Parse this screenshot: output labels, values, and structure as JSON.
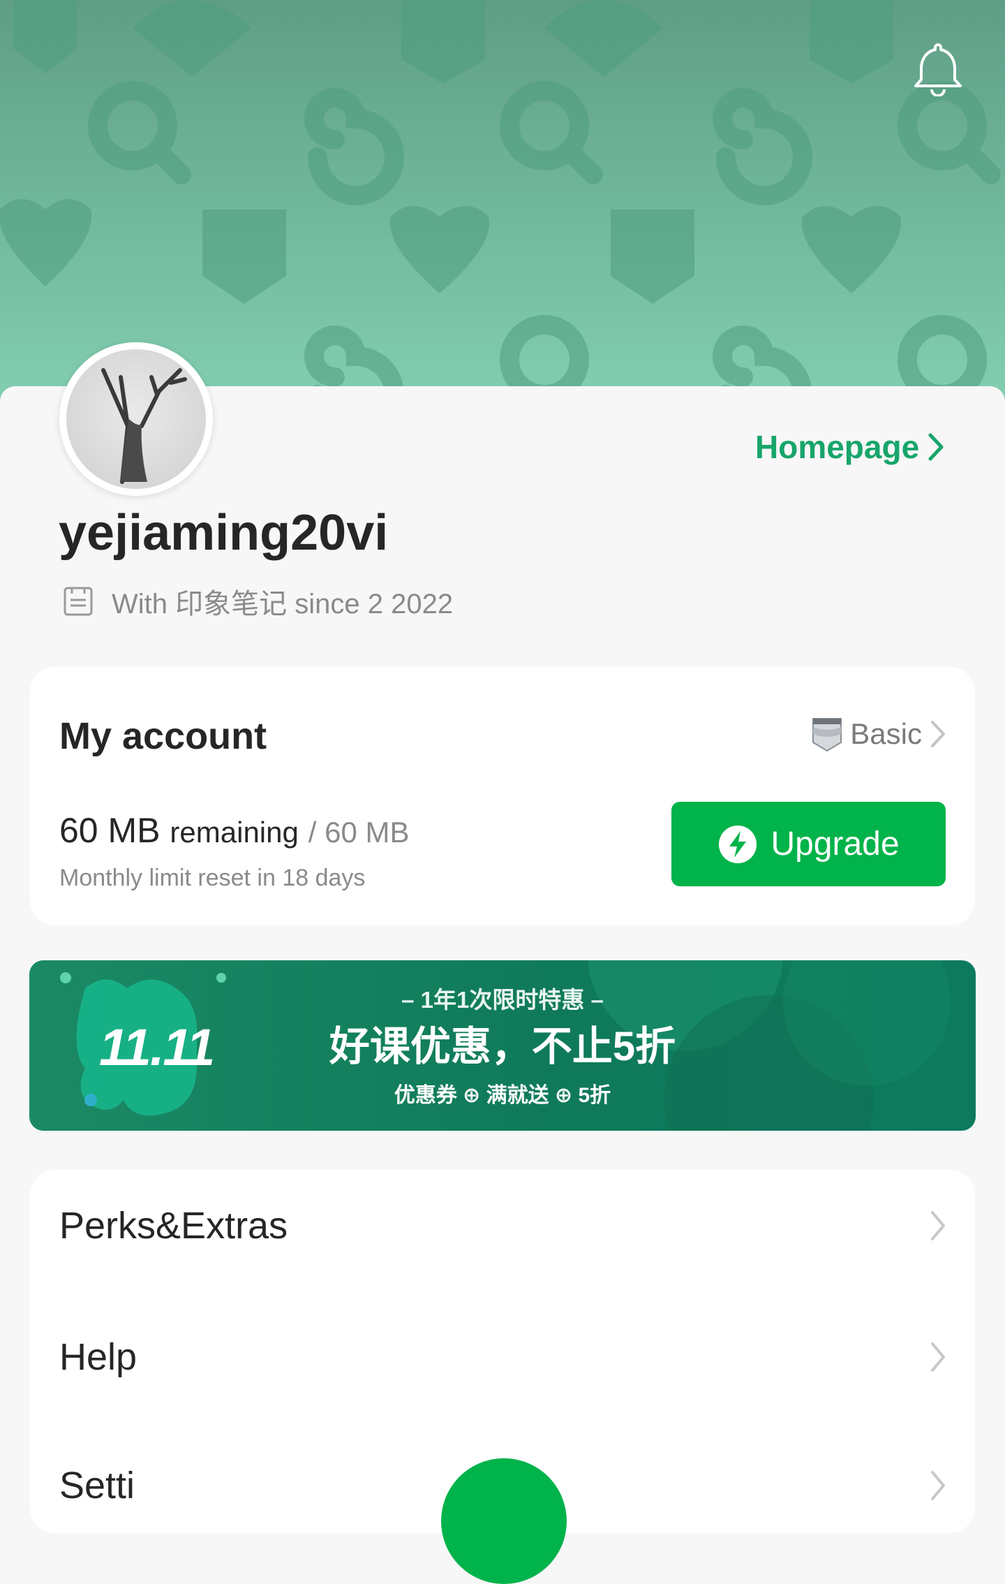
{
  "header": {
    "notification_icon": "bell-icon",
    "homepage_label": "Homepage",
    "accent_color": "#17a56a"
  },
  "profile": {
    "username": "yejiaming20vi",
    "since_text": "With 印象笔记 since 2 2022",
    "since_icon": "calendar-icon",
    "avatar": "tree-drawing-avatar"
  },
  "account": {
    "title": "My account",
    "plan_label": "Basic",
    "plan_icon": "basic-plan-icon",
    "remaining_value": "60 MB",
    "remaining_label": "remaining",
    "total_label": "/ 60 MB",
    "reset_note": "Monthly limit reset in 18 days",
    "upgrade_label": "Upgrade",
    "upgrade_color": "#00b34a"
  },
  "banner": {
    "badge": "11.11",
    "line1": "– 1年1次限时特惠 –",
    "line2": "好课优惠，不止5折",
    "line3": "优惠券 ⊕ 满就送 ⊕ 5折"
  },
  "menu": {
    "items": [
      {
        "label": "Perks&Extras"
      },
      {
        "label": "Help"
      },
      {
        "label": "Setti"
      }
    ]
  }
}
